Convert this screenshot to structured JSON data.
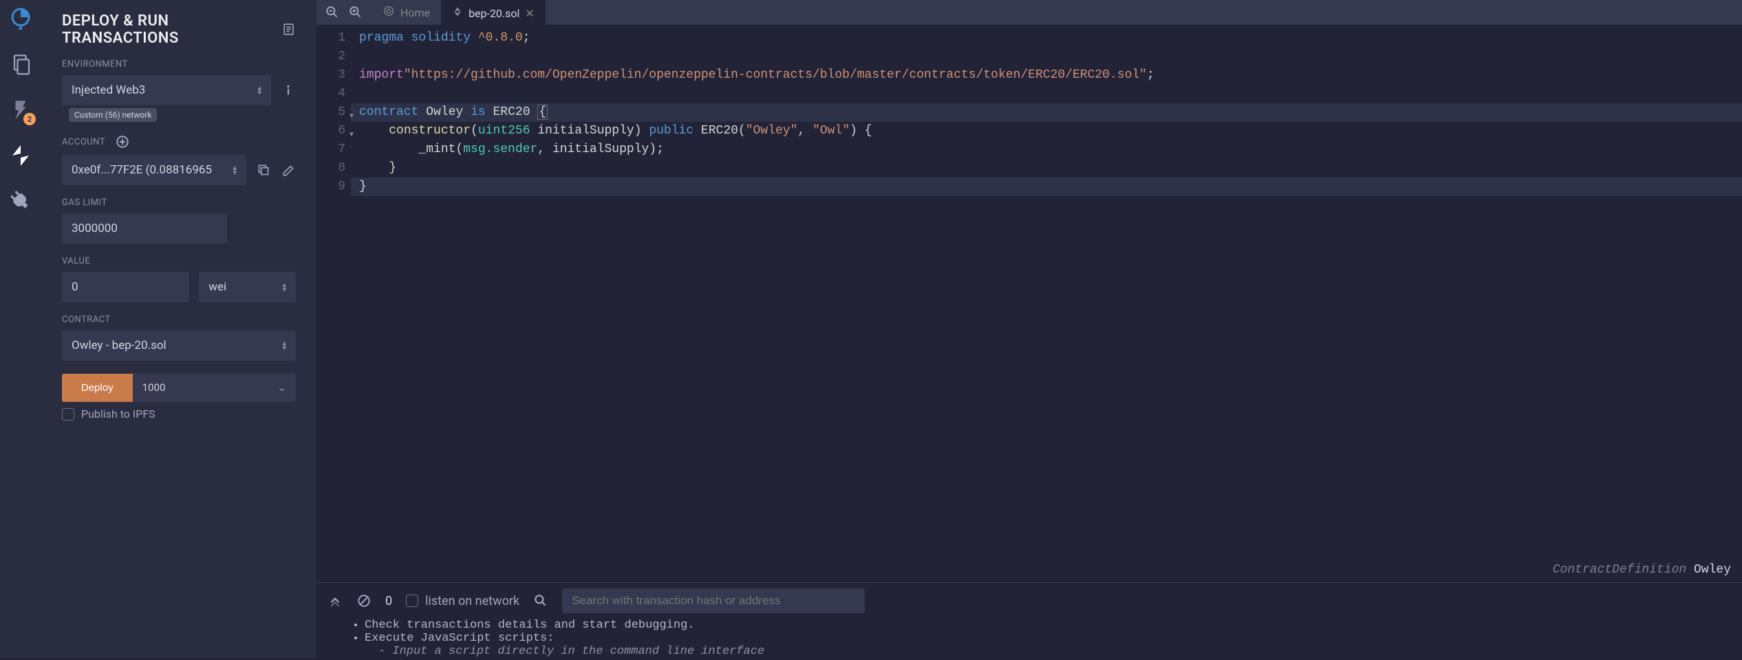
{
  "iconbar": {
    "badge": "2"
  },
  "panel": {
    "title": "DEPLOY & RUN TRANSACTIONS",
    "environment_label": "ENVIRONMENT",
    "environment_value": "Injected Web3",
    "network_pill": "Custom (56) network",
    "account_label": "ACCOUNT",
    "account_value": "0xe0f...77F2E (0.08816965",
    "gas_label": "GAS LIMIT",
    "gas_value": "3000000",
    "value_label": "VALUE",
    "value_amount": "0",
    "value_unit": "wei",
    "contract_label": "CONTRACT",
    "contract_value": "Owley - bep-20.sol",
    "deploy_btn": "Deploy",
    "deploy_param": "1000",
    "publish_label": "Publish to IPFS"
  },
  "tabs": {
    "home": "Home",
    "file": "bep-20.sol"
  },
  "lines": [
    "1",
    "2",
    "3",
    "4",
    "5",
    "6",
    "7",
    "8",
    "9"
  ],
  "code": {
    "l1_a": "pragma",
    "l1_b": "solidity",
    "l1_c": "^0.8.0",
    "l1_d": ";",
    "l3_a": "import",
    "l3_b": "\"https://github.com/OpenZeppelin/openzeppelin-contracts/blob/master/contracts/token/ERC20/ERC20.sol\"",
    "l3_c": ";",
    "l5_a": "contract",
    "l5_b": "Owley",
    "l5_c": "is",
    "l5_d": "ERC20",
    "l5_e": "{",
    "l6_a": "constructor",
    "l6_b": "(",
    "l6_c": "uint256",
    "l6_d": " initialSupply) ",
    "l6_e": "public",
    "l6_f": " ERC20(",
    "l6_g": "\"Owley\"",
    "l6_h": ", ",
    "l6_i": "\"Owl\"",
    "l6_j": ") {",
    "l7_a": "_mint(",
    "l7_b": "msg.sender",
    "l7_c": ", initialSupply);",
    "l8": "}",
    "l9": "}"
  },
  "breadcrumb": {
    "a": "ContractDefinition ",
    "b": "Owley"
  },
  "term": {
    "count": "0",
    "listen": "listen on network",
    "search_placeholder": "Search with transaction hash or address",
    "li1": "Check transactions details and start debugging.",
    "li2": "Execute JavaScript scripts:",
    "sub": "- Input a script directly in the command line interface"
  }
}
